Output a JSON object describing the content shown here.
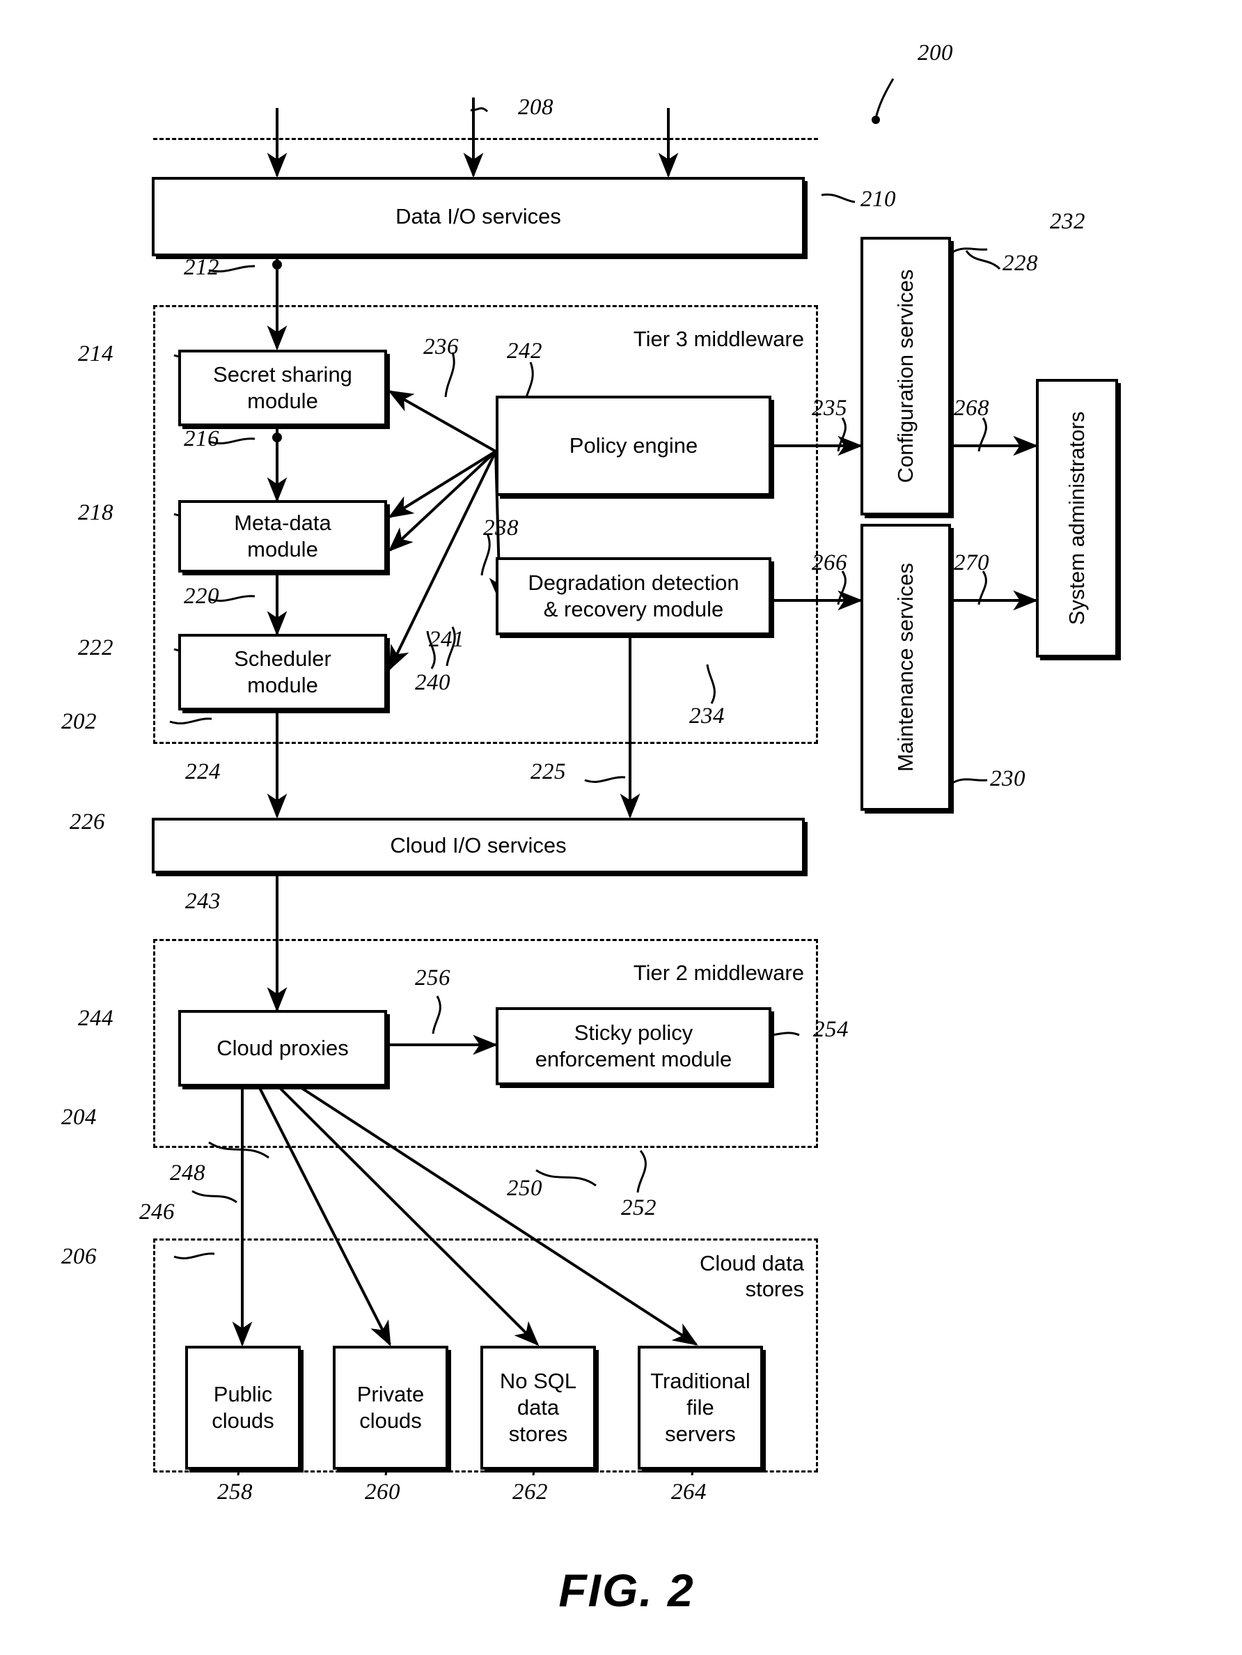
{
  "figure": {
    "caption": "FIG. 2",
    "system_ref": "200"
  },
  "groups": [
    {
      "id": "tier3",
      "caption": "Tier 3 middleware",
      "ref": "202"
    },
    {
      "id": "tier2",
      "caption": "Tier 2 middleware",
      "ref": "204"
    },
    {
      "id": "stores",
      "caption": "Cloud data\nstores",
      "ref": "206"
    }
  ],
  "boxes": {
    "data_io": {
      "label": "Data I/O services",
      "ref": "210"
    },
    "secret_sharing": {
      "label": "Secret sharing\nmodule",
      "ref": "214"
    },
    "meta_data": {
      "label": "Meta-data\nmodule",
      "ref": "218"
    },
    "scheduler": {
      "label": "Scheduler\nmodule",
      "ref": "222"
    },
    "policy_engine": {
      "label": "Policy engine",
      "ref": "242"
    },
    "degradation": {
      "label": "Degradation detection\n& recovery module",
      "ref": "234"
    },
    "cloud_io": {
      "label": "Cloud I/O services",
      "ref": "226"
    },
    "cloud_proxies": {
      "label": "Cloud proxies",
      "ref": "244"
    },
    "sticky_policy": {
      "label": "Sticky policy\nenforcement module",
      "ref": "254"
    },
    "config_services": {
      "label": "Configuration services",
      "ref": "228"
    },
    "maint_services": {
      "label": "Maintenance services",
      "ref": "230"
    },
    "sys_admins": {
      "label": "System administrators",
      "ref": "232"
    },
    "public_clouds": {
      "label": "Public\nclouds",
      "ref": "258"
    },
    "private_clouds": {
      "label": "Private\nclouds",
      "ref": "260"
    },
    "nosql_stores": {
      "label": "No SQL\ndata\nstores",
      "ref": "262"
    },
    "file_servers": {
      "label": "Traditional\nfile\nservers",
      "ref": "264"
    }
  },
  "connector_refs": {
    "c208": "208",
    "c212": "212",
    "c216": "216",
    "c220": "220",
    "c224": "224",
    "c225": "225",
    "c235": "235",
    "c236": "236",
    "c238": "238",
    "c240": "240",
    "c241": "241",
    "c243": "243",
    "c246": "246",
    "c248": "248",
    "c250": "250",
    "c252": "252",
    "c256": "256",
    "c266": "266",
    "c268": "268",
    "c270": "270"
  }
}
